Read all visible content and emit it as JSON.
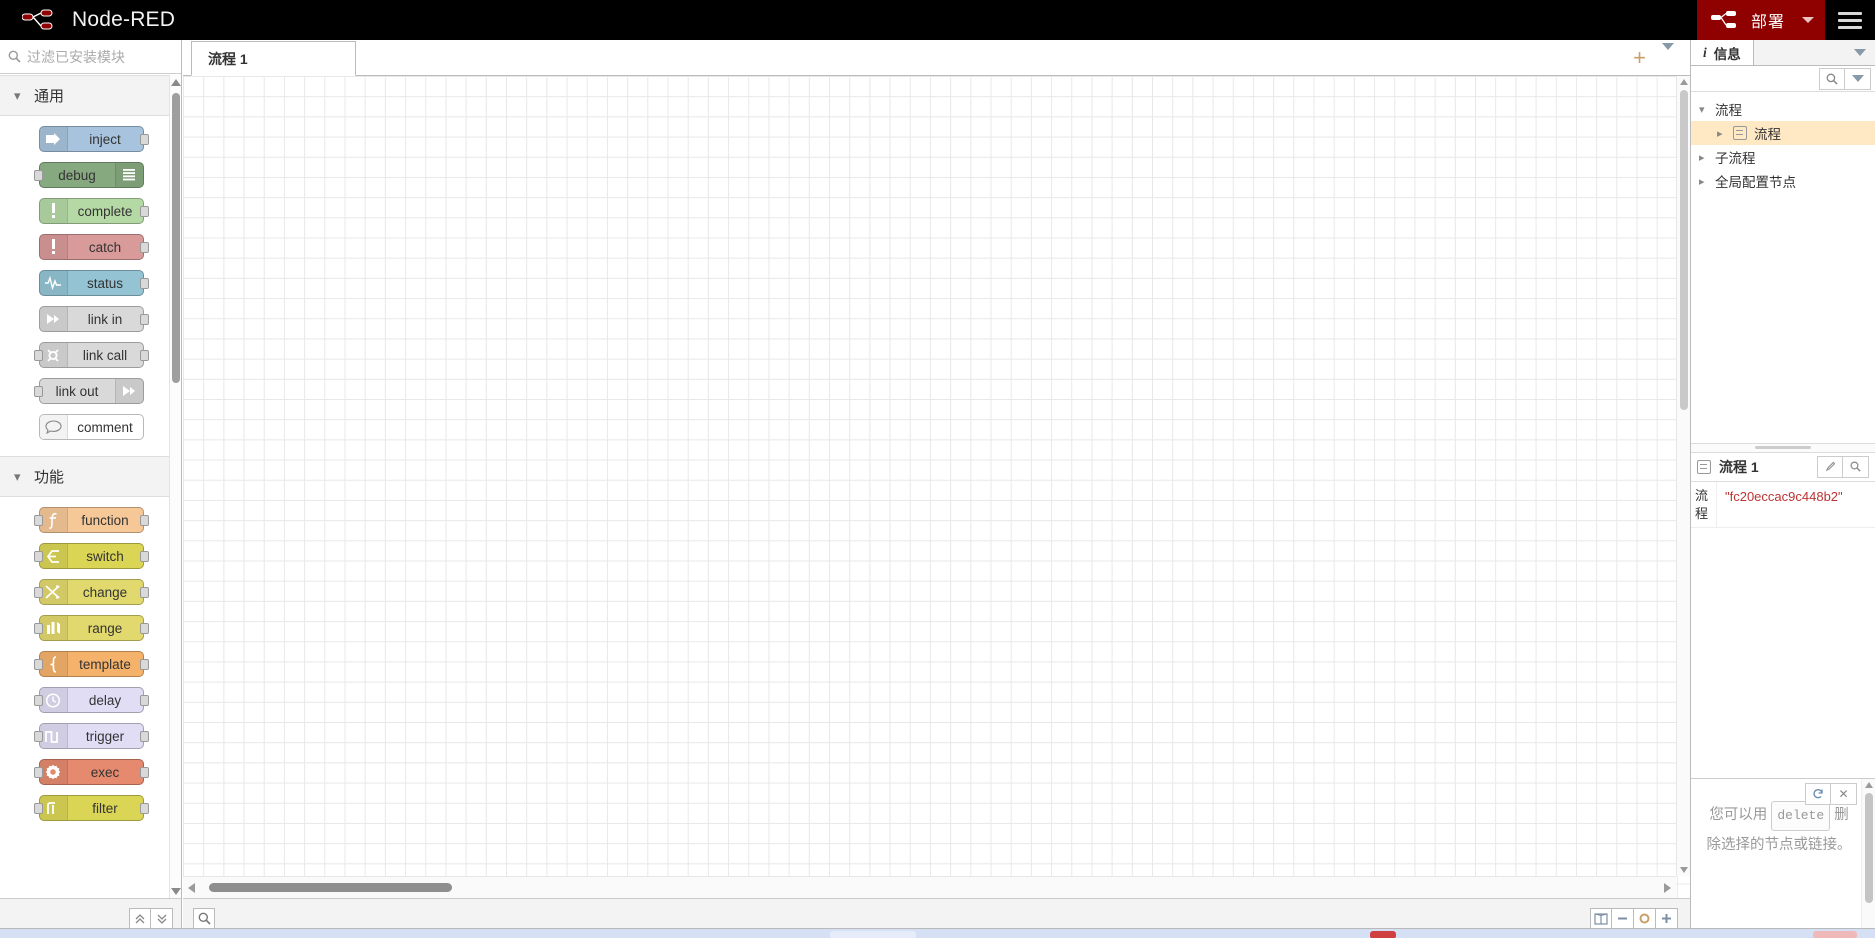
{
  "header": {
    "brand_title": "Node-RED",
    "brand_logo_icon": "node-red-logo-icon",
    "deploy_label": "部署",
    "deploy_logo_icon": "deploy-nodes-icon",
    "deploy_caret_icon": "chevron-down-icon",
    "menu_icon": "hamburger-menu-icon",
    "deploy_color": "#8f0000",
    "bar_color": "#000000"
  },
  "palette": {
    "search_placeholder": "过滤已安装模块",
    "search_value": "",
    "search_icon": "search-icon",
    "scroll_up_icon": "triangle-up-icon",
    "scroll_down_icon": "triangle-down-icon",
    "collapse_all_icon": "chevron-double-up-icon",
    "expand_all_icon": "chevron-double-down-icon",
    "categories": [
      {
        "name": "通用",
        "chevron_icon": "chevron-down-icon",
        "nodes": [
          {
            "label": "inject",
            "color": "#a7c3dd",
            "icon": "arrow-right-icon",
            "icon_side": "left",
            "has_input": false,
            "has_output": true
          },
          {
            "label": "debug",
            "color": "#87a980",
            "icon": "debug-lines-icon",
            "icon_side": "right",
            "has_input": true,
            "has_output": false
          },
          {
            "label": "complete",
            "color": "#b5d9a5",
            "icon": "exclamation-icon",
            "icon_side": "left",
            "has_input": false,
            "has_output": true
          },
          {
            "label": "catch",
            "color": "#d99a9a",
            "icon": "exclamation-icon",
            "icon_side": "left",
            "has_input": false,
            "has_output": true
          },
          {
            "label": "status",
            "color": "#94c4d4",
            "icon": "pulse-wave-icon",
            "icon_side": "left",
            "has_input": false,
            "has_output": true
          },
          {
            "label": "link in",
            "color": "#d9d9d9",
            "icon": "link-in-icon",
            "icon_side": "left",
            "has_input": false,
            "has_output": true
          },
          {
            "label": "link call",
            "color": "#d9d9d9",
            "icon": "link-call-icon",
            "icon_side": "left",
            "has_input": true,
            "has_output": true
          },
          {
            "label": "link out",
            "color": "#d9d9d9",
            "icon": "link-out-icon",
            "icon_side": "right",
            "has_input": true,
            "has_output": false
          },
          {
            "label": "comment",
            "color": "#ffffff",
            "icon": "speech-bubble-icon",
            "icon_side": "left",
            "has_input": false,
            "has_output": false
          }
        ]
      },
      {
        "name": "功能",
        "chevron_icon": "chevron-down-icon",
        "nodes": [
          {
            "label": "function",
            "color": "#f6c898",
            "icon": "function-f-icon",
            "icon_side": "left",
            "has_input": true,
            "has_output": true
          },
          {
            "label": "switch",
            "color": "#dbd556",
            "icon": "switch-fork-icon",
            "icon_side": "left",
            "has_input": true,
            "has_output": true
          },
          {
            "label": "change",
            "color": "#e2d96e",
            "icon": "shuffle-icon",
            "icon_side": "left",
            "has_input": true,
            "has_output": true
          },
          {
            "label": "range",
            "color": "#e2d96e",
            "icon": "range-bars-icon",
            "icon_side": "left",
            "has_input": true,
            "has_output": true
          },
          {
            "label": "template",
            "color": "#f5b26b",
            "icon": "curly-brace-icon",
            "icon_side": "left",
            "has_input": true,
            "has_output": true
          },
          {
            "label": "delay",
            "color": "#e0ddf5",
            "icon": "stopwatch-icon",
            "icon_side": "left",
            "has_input": true,
            "has_output": true
          },
          {
            "label": "trigger",
            "color": "#e0ddf5",
            "icon": "pulse-step-icon",
            "icon_side": "left",
            "has_input": true,
            "has_output": true
          },
          {
            "label": "exec",
            "color": "#e58a6e",
            "icon": "gear-icon",
            "icon_side": "left",
            "has_input": true,
            "has_output": true
          },
          {
            "label": "filter",
            "color": "#dbd556",
            "icon": "filter-step-icon",
            "icon_side": "left",
            "has_input": true,
            "has_output": true
          }
        ]
      }
    ]
  },
  "editor": {
    "tabs": [
      {
        "label": "流程 1",
        "active": true
      }
    ],
    "add_tab_icon": "plus-icon",
    "tab_menu_icon": "chevron-down-icon",
    "footer": {
      "search_icon": "search-icon",
      "navigator_icon": "navigator-map-icon",
      "zoom_out_icon": "minus-icon",
      "zoom_reset_icon": "circle-icon",
      "zoom_in_icon": "plus-icon"
    }
  },
  "sidebar": {
    "tab": {
      "label": "信息",
      "icon": "info-icon"
    },
    "tabs_menu_icon": "chevron-down-icon",
    "toolbar": {
      "search_icon": "search-icon",
      "menu_icon": "chevron-down-icon"
    },
    "tree": [
      {
        "label": "流程",
        "expanded": true,
        "indent": 0,
        "selected": false,
        "icon": null
      },
      {
        "label": "流程",
        "expanded": false,
        "indent": 1,
        "selected": true,
        "icon": "flow-icon"
      },
      {
        "label": "子流程",
        "expanded": false,
        "indent": 0,
        "selected": false,
        "icon": null
      },
      {
        "label": "全局配置节点",
        "expanded": false,
        "indent": 0,
        "selected": false,
        "icon": null
      }
    ],
    "property_panel": {
      "title": "流程 1",
      "title_icon": "flow-icon",
      "edit_icon": "pencil-icon",
      "search_icon": "search-icon",
      "rows": [
        {
          "key": "流程",
          "value": "\"fc20eccac9c448b2\""
        }
      ]
    },
    "tip": {
      "refresh_icon": "refresh-icon",
      "close_icon": "close-icon",
      "text_before": "您可以用",
      "key": "delete",
      "text_after": "删除选择的节点或链接。"
    }
  }
}
